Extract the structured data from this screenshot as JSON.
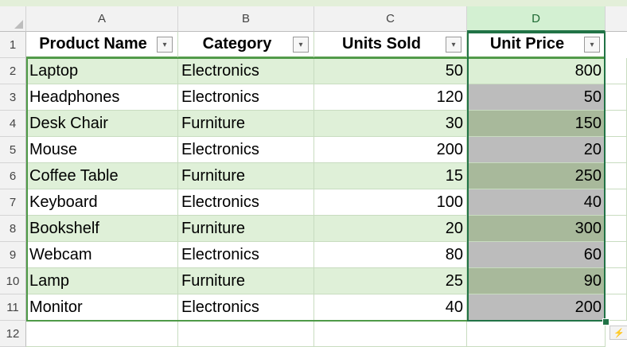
{
  "columns": [
    "A",
    "B",
    "C",
    "D"
  ],
  "rows": [
    "1",
    "2",
    "3",
    "4",
    "5",
    "6",
    "7",
    "8",
    "9",
    "10",
    "11",
    "12"
  ],
  "table": {
    "headers": [
      "Product Name",
      "Category",
      "Units Sold",
      "Unit Price"
    ],
    "data": [
      [
        "Laptop",
        "Electronics",
        "50",
        "800"
      ],
      [
        "Headphones",
        "Electronics",
        "120",
        "50"
      ],
      [
        "Desk Chair",
        "Furniture",
        "30",
        "150"
      ],
      [
        "Mouse",
        "Electronics",
        "200",
        "20"
      ],
      [
        "Coffee Table",
        "Furniture",
        "15",
        "250"
      ],
      [
        "Keyboard",
        "Electronics",
        "100",
        "40"
      ],
      [
        "Bookshelf",
        "Furniture",
        "20",
        "300"
      ],
      [
        "Webcam",
        "Electronics",
        "80",
        "60"
      ],
      [
        "Lamp",
        "Furniture",
        "25",
        "90"
      ],
      [
        "Monitor",
        "Electronics",
        "40",
        "200"
      ]
    ]
  },
  "filter_icon": "dropdown-arrow-icon",
  "quick_analysis_icon": "quick-analysis-icon"
}
